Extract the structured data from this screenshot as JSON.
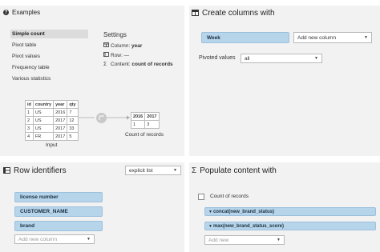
{
  "examples": {
    "title": "Examples",
    "items": [
      "Simple count",
      "Pivot table",
      "Pivot values",
      "Frequency table",
      "Various statistics"
    ],
    "active_index": 0,
    "settings": {
      "title": "Settings",
      "column_label": "Column:",
      "column_value": "year",
      "row_label": "Row:",
      "row_value": "—",
      "content_label": "Content:",
      "content_value": "count of records"
    },
    "input_table": {
      "headers": [
        "id",
        "country",
        "year",
        "qty"
      ],
      "rows": [
        [
          "1",
          "US",
          "2016",
          "7"
        ],
        [
          "2",
          "US",
          "2017",
          "12"
        ],
        [
          "3",
          "US",
          "2017",
          "33"
        ],
        [
          "4",
          "FR",
          "2017",
          "5"
        ]
      ],
      "caption": "Input"
    },
    "output_table": {
      "headers": [
        "2016",
        "2017"
      ],
      "rows": [
        [
          "1",
          "3"
        ]
      ],
      "caption": "Count of records"
    }
  },
  "create_columns": {
    "title": "Create columns with",
    "column_pill": "Week",
    "add_column_placeholder": "Add new column",
    "pivoted_values_label": "Pivoted values",
    "pivoted_values_selected": "all"
  },
  "row_identifiers": {
    "title": "Row identifiers",
    "mode_selected": "explicit list",
    "columns": [
      "license number",
      "CUSTOMER_NAME",
      "brand"
    ],
    "add_column_placeholder": "Add new column"
  },
  "populate_content": {
    "title": "Populate content with",
    "count_label": "Count of records",
    "aggregations": [
      "concat(new_brand_status)",
      "max(new_brand_status_score)"
    ],
    "add_placeholder": "Add new"
  },
  "colors": {
    "panel_bg": "#f2f2f2",
    "pill_bg": "#b6d4ea",
    "pill_border": "#9cc0dd",
    "active_item_bg": "#dcdcdc"
  }
}
